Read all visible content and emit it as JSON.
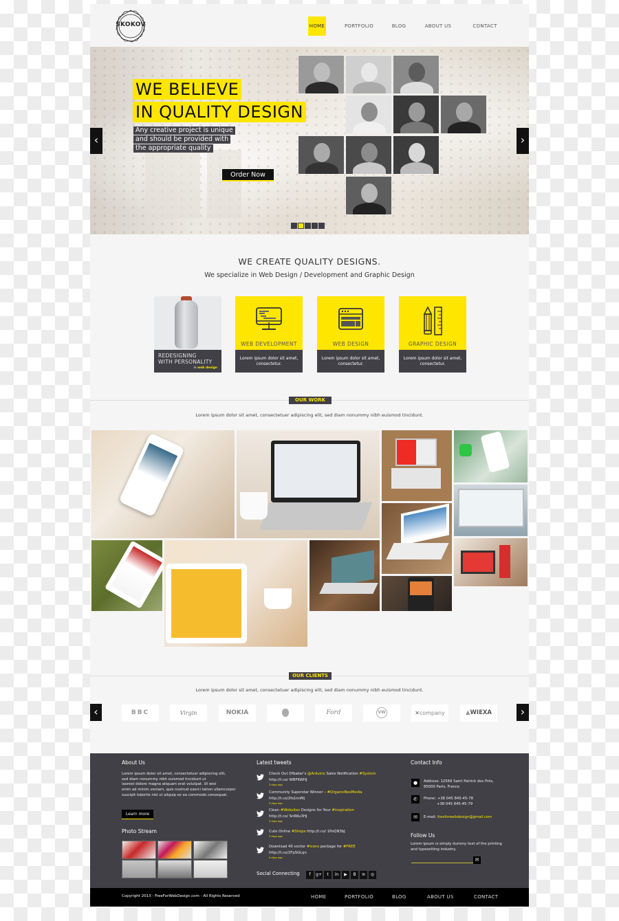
{
  "header": {
    "logo_text": "SKOKOV",
    "nav": [
      {
        "label": "HOME",
        "active": true
      },
      {
        "label": "PORTFOLIO",
        "active": false
      },
      {
        "label": "BLOG",
        "active": false
      },
      {
        "label": "ABOUT US",
        "active": false
      },
      {
        "label": "CONTACT",
        "active": false
      }
    ]
  },
  "hero": {
    "headline_line1": "WE BELIEVE",
    "headline_line2": "IN QUALITY DESIGN",
    "sub_line1": "Any creative project is unique",
    "sub_line2": "and should be provided with",
    "sub_line3": "the appropriate quality",
    "cta_label": "Order Now",
    "prev_icon": "‹",
    "next_icon": "›",
    "slide_count": 5,
    "active_slide": 2,
    "team_photo_count": 10
  },
  "services": {
    "title": "WE CREATE QUALITY DESIGNS.",
    "subtitle": "We specialize in Web Design / Development and Graphic Design",
    "featured": {
      "caption_line1": "REDESIGNING",
      "caption_line2": "WITH PERSONALITY",
      "tag_prefix": "in",
      "tag": "web design"
    },
    "cards": [
      {
        "label": "WEB DEVELOPMENT",
        "text_line1": "Lorem ipsum dolor sit amet,",
        "text_line2": "consectetur.",
        "icon": "monitor-code-icon"
      },
      {
        "label": "WEB DESIGN",
        "text_line1": "Lorem ipsum dolor sit amet,",
        "text_line2": "consectetur.",
        "icon": "browser-window-icon"
      },
      {
        "label": "GRAPHIC DESIGN",
        "text_line1": "Lorem ipsum dolor sit amet,",
        "text_line2": "consectetur.",
        "icon": "pencil-ruler-icon"
      }
    ]
  },
  "work": {
    "tag": "OUR WORK",
    "text": "Lorem ipsum dolor sit amet, consectetuer adipiscing elit, sed diam nonummy nibh euismod tincidunt.",
    "tiles": [
      {
        "subject": "smartphone in hand"
      },
      {
        "subject": "laptop with coffee"
      },
      {
        "subject": "laptop red screen"
      },
      {
        "subject": "whatsapp phone"
      },
      {
        "subject": "laptop website"
      },
      {
        "subject": "tablet on lap"
      },
      {
        "subject": "tablet dish app"
      },
      {
        "subject": "laptop on desk"
      },
      {
        "subject": "laptop with cup"
      },
      {
        "subject": "laptop red product"
      },
      {
        "subject": "tablet food app"
      }
    ]
  },
  "clients": {
    "tag": "OUR CLIENTS",
    "text": "Lorem ipsum dolor sit amet, consectetuer adipiscing elit, sed diam nonummy nibh euismod tincidunt.",
    "logos": [
      "BBC",
      "Virgin",
      "NOKIA",
      "",
      "Ford",
      "VW",
      "company",
      "WIEXA"
    ],
    "prev_icon": "‹",
    "next_icon": "›"
  },
  "footer": {
    "about": {
      "title": "About Us",
      "lines": [
        "Lorem ipsum dolor sit amet, consectetuer adipiscing elit,",
        "sed diam nonummy nibh euismod tincidunt ut",
        "laoreet dolore magna aliquam erat volutpat. Ut wisi",
        "enim ad minim veniam, quis nostrud exerci tation ullamcorper",
        "suscipit lobortis nisl ut aliquip ex ea commodo consequat."
      ],
      "button": "Learn more"
    },
    "photo_stream": {
      "title": "Photo Stream",
      "count": 6
    },
    "tweets": {
      "title": "Latest tweets",
      "items": [
        {
          "pre": "Check Out Dfbaker's ",
          "h1": "@Arduino",
          "mid": " Sales Notification ",
          "h2": "#System",
          "link": "http://t.co/ WBFKWHJ",
          "time": "3 days ago"
        },
        {
          "pre": "Community Superstar Winner – ",
          "h1": "#OrganicBeeMedia",
          "mid": "",
          "h2": "",
          "link": "http://t.co/2fs1nnMj",
          "time": "3 days ago"
        },
        {
          "pre": "Clean ",
          "h1": "#Websites",
          "mid": " Designs for Your ",
          "h2": "#inspiration",
          "link": "http://t.co/ SnRKu3HJ",
          "time": "3 days ago"
        },
        {
          "pre": "Cute Online ",
          "h1": "#Shops",
          "mid": " http://t.co/ 1PoQN3bJ",
          "h2": "",
          "link": "",
          "time": "3 days ago"
        },
        {
          "pre": "Download 40 vector ",
          "h1": "#icons",
          "mid": " package for ",
          "h2": "#FREE",
          "link": "http://t.co/2FpSGLqn",
          "time": "4 days ago"
        }
      ],
      "social_label": "Social Connecting",
      "social": [
        {
          "name": "facebook",
          "glyph": "f"
        },
        {
          "name": "google-plus",
          "glyph": "g+"
        },
        {
          "name": "twitter",
          "glyph": "t"
        },
        {
          "name": "linkedin",
          "glyph": "in"
        },
        {
          "name": "youtube",
          "glyph": "▶"
        },
        {
          "name": "blogger",
          "glyph": "B"
        },
        {
          "name": "rss",
          "glyph": "≋"
        },
        {
          "name": "dribbble",
          "glyph": "◎"
        }
      ]
    },
    "contact": {
      "title": "Contact Info",
      "address_line1": "Address: 12569 Saint Patrick des Prés,",
      "address_line2": "85000 Paris, France",
      "phone_line1": "Phone: +38 045 845-45-78",
      "phone_line2": "+38 045 845-45-79",
      "email_label": "E-mail: ",
      "email": "freeforwebdesign@gmail.com",
      "follow_title": "Follow Us",
      "follow_line1": "Lorem Ipsum is simply dummy text of the printing",
      "follow_line2": "and typesetting industry.",
      "input_value": "",
      "input_placeholder": ""
    }
  },
  "bottom_bar": {
    "copyright": "Copyright 2013 - FreeForWebDesign.com - All Rights Reserved",
    "nav": [
      "HOME",
      "PORTFOLIO",
      "BLOG",
      "ABOUT US",
      "CONTACT"
    ]
  },
  "colors": {
    "accent": "#ffe600",
    "dark": "#414047",
    "black": "#000000",
    "page_bg": "#f5f5f5"
  }
}
